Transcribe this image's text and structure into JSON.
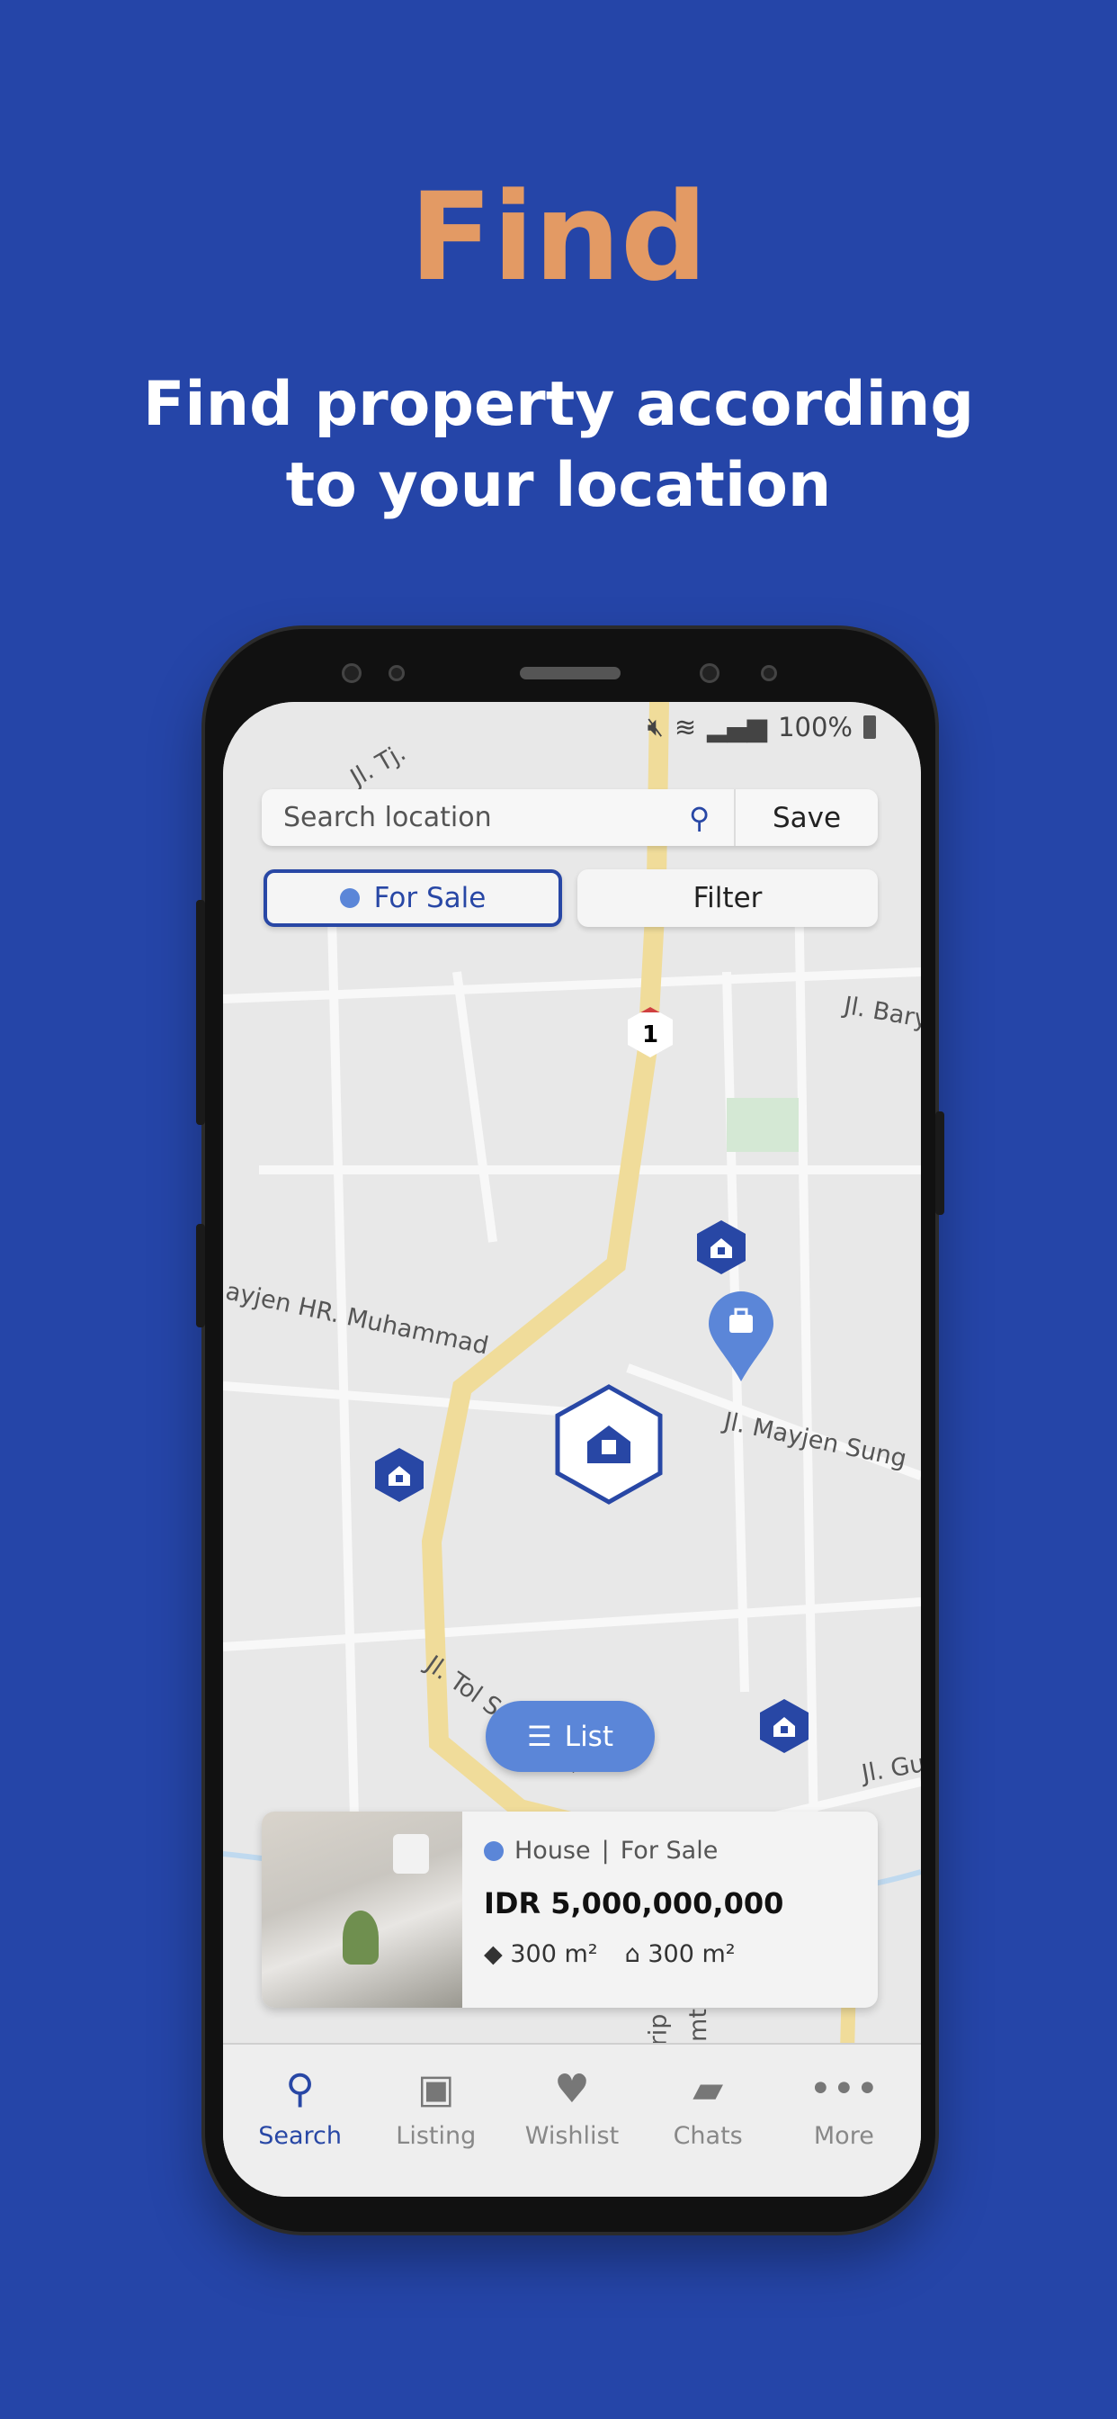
{
  "headline": "Find",
  "subtitle_line1": "Find property according",
  "subtitle_line2": "to your location",
  "colors": {
    "background": "#2545a8",
    "headline": "#e39a64",
    "accent": "#2847a5",
    "marker_light": "#5b86d8"
  },
  "status_bar": {
    "battery": "100%",
    "icons": [
      "mute-icon",
      "wifi-icon",
      "signal-icon",
      "battery-icon"
    ]
  },
  "search": {
    "placeholder": "Search location",
    "save_label": "Save"
  },
  "filters": {
    "for_sale": "For Sale",
    "filter": "Filter"
  },
  "map": {
    "labels": [
      "Jl. Tj.",
      "Jl. Bary",
      "ayjen HR. Muhammad",
      "Jl. Mayjen Sung",
      "Jl. Tol Surabaya",
      "Jl. Gu",
      "rip",
      "mt"
    ],
    "route_number": "1"
  },
  "list_button": "List",
  "card": {
    "type": "House",
    "status": "For Sale",
    "separator": "|",
    "price": "IDR 5,000,000,000",
    "land_area": "300 m²",
    "building_area": "300 m²"
  },
  "nav": [
    {
      "label": "Search",
      "icon": "search-icon",
      "active": true
    },
    {
      "label": "Listing",
      "icon": "listing-icon"
    },
    {
      "label": "Wishlist",
      "icon": "heart-icon"
    },
    {
      "label": "Chats",
      "icon": "chat-icon"
    },
    {
      "label": "More",
      "icon": "more-icon"
    }
  ]
}
